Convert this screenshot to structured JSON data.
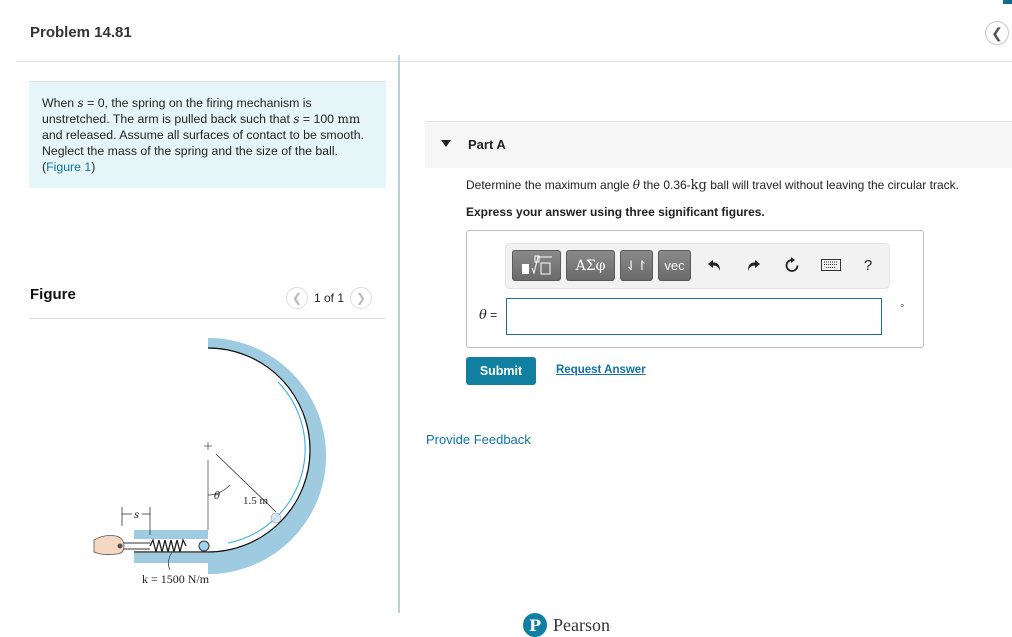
{
  "header": {
    "problem_title": "Problem 14.81",
    "back_icon": "chevron-left-icon"
  },
  "problem": {
    "text_parts": {
      "p1": "When ",
      "s1": "s",
      "p2": " = 0, the spring on the firing mechanism is unstretched. The arm is pulled back such that ",
      "s2": "s",
      "p3": " = 100 ",
      "unit": "mm",
      "p4": " and released. Assume all surfaces of contact to be smooth. Neglect the mass of the spring and the size of the ball. (",
      "figure_link": "Figure 1",
      "p5": ")"
    }
  },
  "figure": {
    "title": "Figure",
    "pager": "1 of 1",
    "prev_icon": "chevron-left-icon",
    "next_icon": "chevron-right-icon",
    "labels": {
      "s": "s",
      "theta": "θ",
      "radius": "1.5 m",
      "spring": "k = 1500 N/m"
    },
    "colors": {
      "track": "#9fcbe0",
      "path": "#27a9e1"
    }
  },
  "part": {
    "title": "Part A",
    "question_pre": "Determine the maximum angle ",
    "question_var": "θ",
    "question_mid": " the 0.36-",
    "question_unit": "kg",
    "question_post": " ball will travel without leaving the circular track.",
    "instruction": "Express your answer using three significant figures."
  },
  "toolbar": {
    "buttons": [
      {
        "name": "templates-button",
        "label": "▮∜▢"
      },
      {
        "name": "greek-symbols-button",
        "label": "ΑΣφ"
      },
      {
        "name": "arrows-button",
        "label": "⇃↾"
      },
      {
        "name": "vector-button",
        "label": "vec"
      }
    ],
    "icons": {
      "undo": "↶",
      "redo": "↷",
      "reset": "↻",
      "keyboard": "⌨",
      "help": "?"
    }
  },
  "answer": {
    "label_var": "θ",
    "label_eq": " =",
    "value": "",
    "unit": "°"
  },
  "actions": {
    "submit": "Submit",
    "request_answer": "Request Answer",
    "feedback": "Provide Feedback"
  },
  "footer": {
    "brand_logo": "P",
    "brand": "Pearson"
  },
  "colors": {
    "accent": "#107fa0",
    "link": "#0f73a5",
    "problem_bg": "#e6f6f8"
  }
}
